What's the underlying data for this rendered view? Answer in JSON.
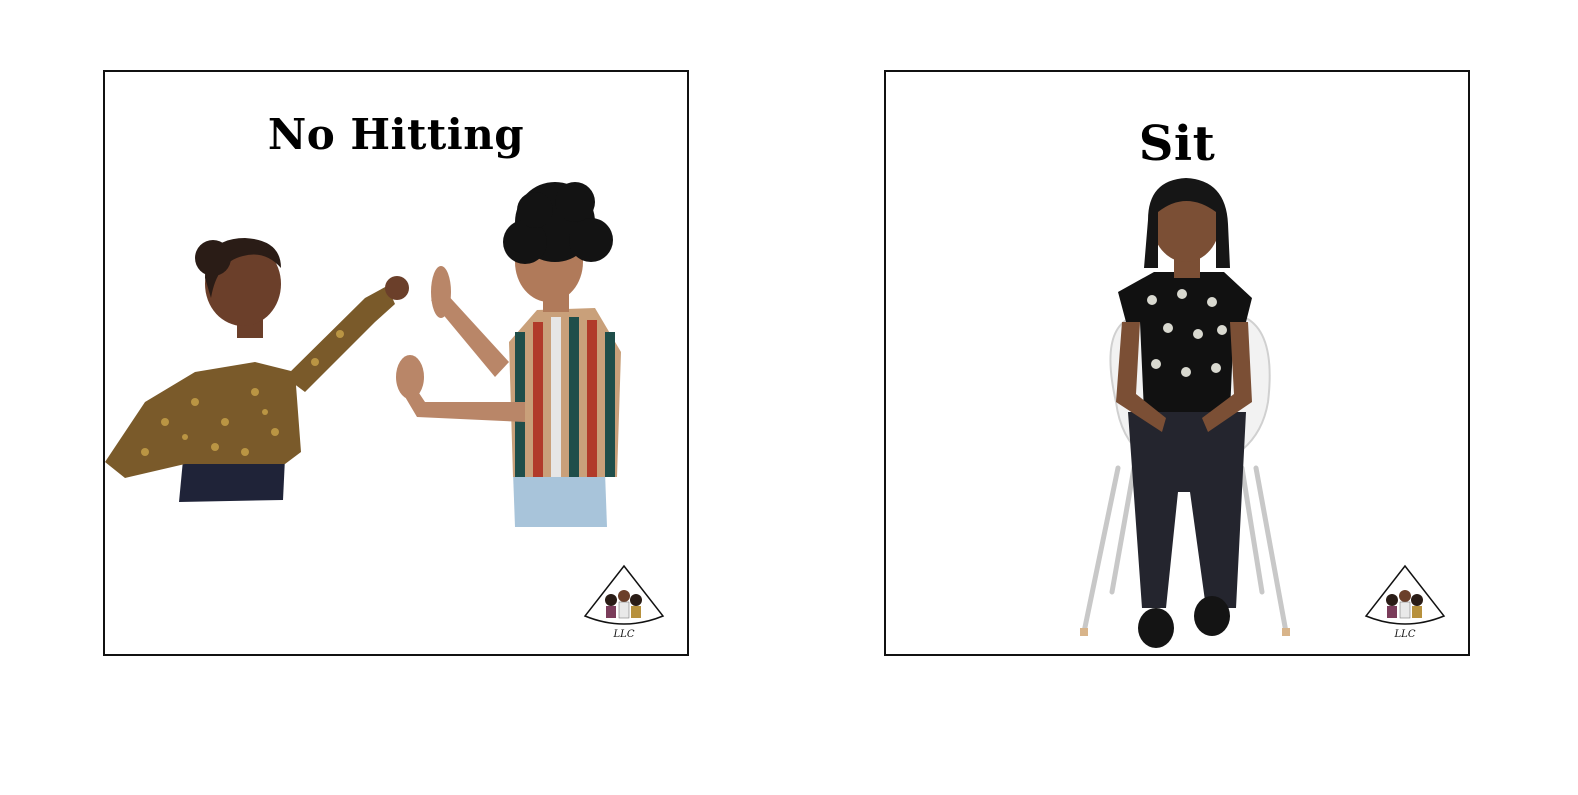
{
  "cards": [
    {
      "title": "No Hitting",
      "logo": {
        "llc": "LLC"
      }
    },
    {
      "title": "Sit",
      "logo": {
        "llc": "LLC"
      }
    }
  ]
}
